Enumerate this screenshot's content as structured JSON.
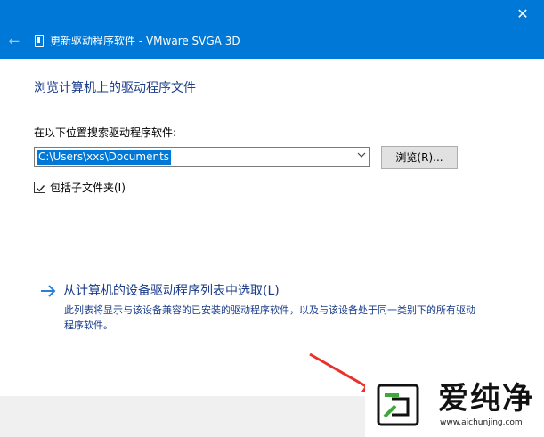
{
  "window": {
    "title": "更新驱动程序软件 - VMware SVGA 3D",
    "close_glyph": "✕",
    "back_glyph": "←"
  },
  "content": {
    "heading": "浏览计算机上的驱动程序文件",
    "search_label": "在以下位置搜索驱动程序软件:",
    "path_value": "C:\\Users\\xxs\\Documents",
    "browse_label": "浏览(R)...",
    "include_subfolders_label": "包括子文件夹(I)",
    "include_subfolders_checked": true
  },
  "pick_option": {
    "title": "从计算机的设备驱动程序列表中选取(L)",
    "description": "此列表将显示与该设备兼容的已安装的驱动程序软件，以及与该设备处于同一类别下的所有驱动程序软件。"
  },
  "watermark": {
    "text": "爱纯净",
    "url": "www.aichunjing.com"
  },
  "colors": {
    "titlebar": "#0078d7",
    "link": "#1a3c8a",
    "arrow": "#2b7fd6",
    "annotation": "#e8322b",
    "logo_green": "#3ea83a"
  },
  "icons": {
    "back": "back-arrow-icon",
    "device": "device-icon",
    "dropdown": "chevron-down-icon",
    "pick": "arrow-right-icon",
    "check": "checkmark-icon"
  }
}
